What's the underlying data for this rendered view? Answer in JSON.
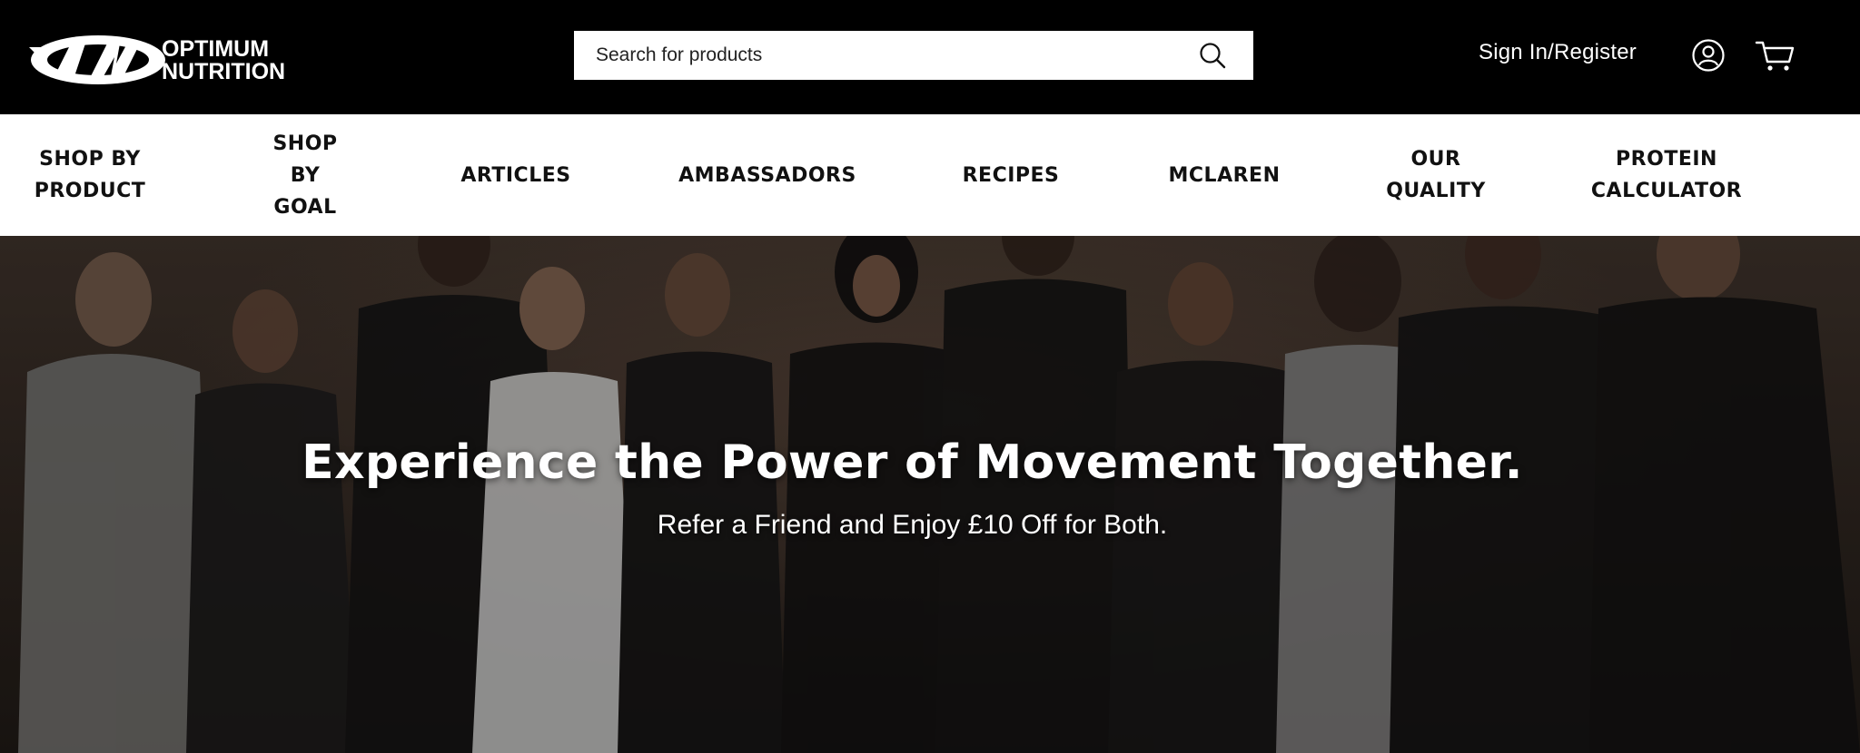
{
  "header": {
    "logo_text": "OPTIMUM NUTRITION",
    "logo_mark": "ON",
    "search_placeholder": "Search for products",
    "sign_in_label": "Sign In/Register",
    "icons": [
      "search-icon",
      "account-icon",
      "cart-icon"
    ]
  },
  "nav": {
    "items": [
      {
        "label": "SHOP BY\nPRODUCT"
      },
      {
        "label": "SHOP\nBY\nGOAL"
      },
      {
        "label": "ARTICLES"
      },
      {
        "label": "AMBASSADORS"
      },
      {
        "label": "RECIPES"
      },
      {
        "label": "MCLAREN"
      },
      {
        "label": "OUR\nQUALITY"
      },
      {
        "label": "PROTEIN\nCALCULATOR"
      }
    ]
  },
  "hero": {
    "title": "Experience the Power of Movement Together.",
    "subtitle": "Refer a Friend and Enjoy £10 Off for Both.",
    "image_description": "group-of-athletes-photo"
  },
  "colors": {
    "header_bg": "#000000",
    "nav_bg": "#ffffff",
    "nav_text": "#111111",
    "hero_text": "#ffffff"
  }
}
